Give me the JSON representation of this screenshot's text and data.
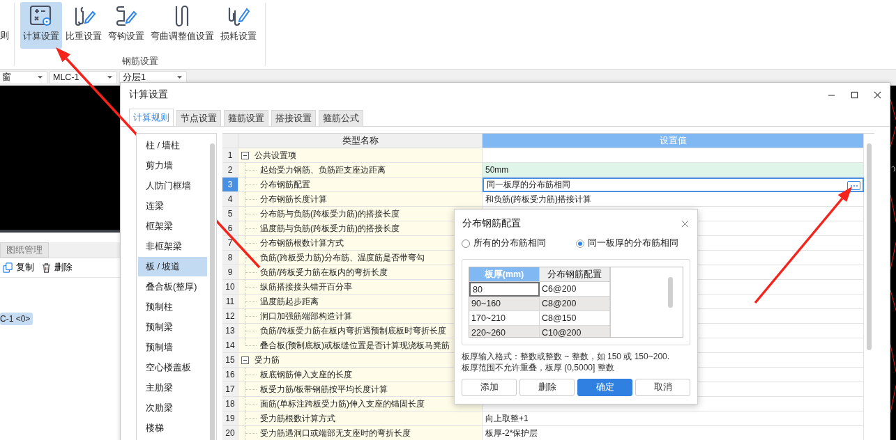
{
  "ribbon": {
    "cut_label": "则",
    "buttons": [
      {
        "label": "计算设置",
        "selected": true
      },
      {
        "label": "比重设置",
        "selected": false
      },
      {
        "label": "弯钩设置",
        "selected": false
      },
      {
        "label": "弯曲调整值设置",
        "selected": false
      },
      {
        "label": "损耗设置",
        "selected": false
      }
    ],
    "group_label": "钢筋设置"
  },
  "selectors": [
    "窗",
    "MLC-1",
    "分层1"
  ],
  "side_panel": {
    "tab": "图纸管理",
    "actions": [
      "复制",
      "删除"
    ],
    "item": "C-1 <0>"
  },
  "dialog": {
    "title": "计算设置",
    "tabs": [
      {
        "label": "计算规则",
        "selected": true
      },
      {
        "label": "节点设置",
        "selected": false
      },
      {
        "label": "箍筋设置",
        "selected": false
      },
      {
        "label": "搭接设置",
        "selected": false
      },
      {
        "label": "箍筋公式",
        "selected": false
      }
    ],
    "categories": [
      {
        "label": "柱 / 墙柱",
        "selected": false
      },
      {
        "label": "剪力墙",
        "selected": false
      },
      {
        "label": "人防门框墙",
        "selected": false
      },
      {
        "label": "连梁",
        "selected": false
      },
      {
        "label": "框架梁",
        "selected": false
      },
      {
        "label": "非框架梁",
        "selected": false
      },
      {
        "label": "板 / 坡道",
        "selected": true
      },
      {
        "label": "叠合板(整厚)",
        "selected": false
      },
      {
        "label": "预制柱",
        "selected": false
      },
      {
        "label": "预制梁",
        "selected": false
      },
      {
        "label": "预制墙",
        "selected": false
      },
      {
        "label": "空心楼盖板",
        "selected": false
      },
      {
        "label": "主肋梁",
        "selected": false
      },
      {
        "label": "次肋梁",
        "selected": false
      },
      {
        "label": "楼梯",
        "selected": false
      }
    ],
    "table": {
      "columns": [
        {
          "label": "类型名称",
          "selected": false
        },
        {
          "label": "设置值",
          "selected": true
        }
      ],
      "rows": [
        {
          "number": "1",
          "kind": "group",
          "name": "公共设置项",
          "expanded": true,
          "selected": false,
          "modified": false
        },
        {
          "number": "2",
          "kind": "item",
          "name": "起始受力钢筋、负筋距支座边距离",
          "value": "50mm",
          "selected": false,
          "modified": true
        },
        {
          "number": "3",
          "kind": "item",
          "name": "分布钢筋配置",
          "value": "同一板厚的分布筋相同",
          "selected": true,
          "modified": false
        },
        {
          "number": "4",
          "kind": "item",
          "name": "分布钢筋长度计算",
          "value": "和负筋(跨板受力筋)搭接计算",
          "selected": false,
          "modified": false
        },
        {
          "number": "5",
          "kind": "item",
          "name": "分布筋与负筋(跨板受力筋)的搭接长度",
          "selected": false,
          "modified": false
        },
        {
          "number": "6",
          "kind": "item",
          "name": "温度筋与负筋(跨板受力筋)的搭接长度",
          "selected": false,
          "modified": false
        },
        {
          "number": "7",
          "kind": "item",
          "name": "分布钢筋根数计算方式",
          "selected": false,
          "modified": false
        },
        {
          "number": "8",
          "kind": "item",
          "name": "负筋(跨板受力筋)分布筋、温度筋是否带弯勾",
          "selected": false,
          "modified": false
        },
        {
          "number": "9",
          "kind": "item",
          "name": "负筋/跨板受力筋在板内的弯折长度",
          "selected": false,
          "modified": false
        },
        {
          "number": "10",
          "kind": "item",
          "name": "纵筋搭接接头错开百分率",
          "selected": false,
          "modified": false
        },
        {
          "number": "11",
          "kind": "item",
          "name": "温度筋起步距离",
          "selected": false,
          "modified": false
        },
        {
          "number": "12",
          "kind": "item",
          "name": "洞口加强筋端部构造计算",
          "selected": false,
          "modified": false
        },
        {
          "number": "13",
          "kind": "item",
          "name": "负筋/跨板受力筋在板内弯折遇预制底板时弯折长度",
          "selected": false,
          "modified": false
        },
        {
          "number": "14",
          "kind": "item",
          "name": "叠合板(预制底板)或板缝位置是否计算现浇板马凳筋",
          "selected": false,
          "modified": false
        },
        {
          "number": "15",
          "kind": "group",
          "name": "受力筋",
          "expanded": true,
          "selected": false,
          "modified": false
        },
        {
          "number": "16",
          "kind": "item",
          "name": "板底钢筋伸入支座的长度",
          "selected": false,
          "modified": false
        },
        {
          "number": "17",
          "kind": "item",
          "name": "板受力筋/板带钢筋按平均长度计算",
          "selected": false,
          "modified": false
        },
        {
          "number": "18",
          "kind": "item",
          "name": "面筋(单标注跨板受力筋)伸入支座的锚固长度",
          "selected": false,
          "modified": false
        },
        {
          "number": "19",
          "kind": "item",
          "name": "受力筋根数计算方式",
          "value": "向上取整+1",
          "selected": false,
          "modified": false
        },
        {
          "number": "20",
          "kind": "item",
          "name": "受力筋遇洞口或端部无支座时的弯折长度",
          "value": "板厚-2*保护层",
          "selected": false,
          "modified": false
        }
      ]
    }
  },
  "popup": {
    "title": "分布钢筋配置",
    "options": [
      {
        "label": "所有的分布筋相同",
        "selected": false
      },
      {
        "label": "同一板厚的分布筋相同",
        "selected": true
      }
    ],
    "table": {
      "columns": [
        {
          "label": "板厚(mm)",
          "selected": true
        },
        {
          "label": "分布钢筋配置",
          "selected": false
        }
      ],
      "rows": [
        {
          "thickness": "80",
          "config": "C6@200",
          "selected": true
        },
        {
          "thickness": "90~160",
          "config": "C8@200",
          "selected": false
        },
        {
          "thickness": "170~210",
          "config": "C8@150",
          "selected": false
        },
        {
          "thickness": "220~260",
          "config": "C10@200",
          "selected": false
        }
      ]
    },
    "notes": [
      "板厚输入格式：整数或整数 ~ 整数，如 150 或 150~200.",
      "板厚范围不允许重叠，板厚 (0,5000] 整数"
    ],
    "buttons": [
      {
        "label": "添加",
        "primary": false
      },
      {
        "label": "删除",
        "primary": false
      },
      {
        "label": "确定",
        "primary": true
      },
      {
        "label": "取消",
        "primary": false
      }
    ]
  }
}
